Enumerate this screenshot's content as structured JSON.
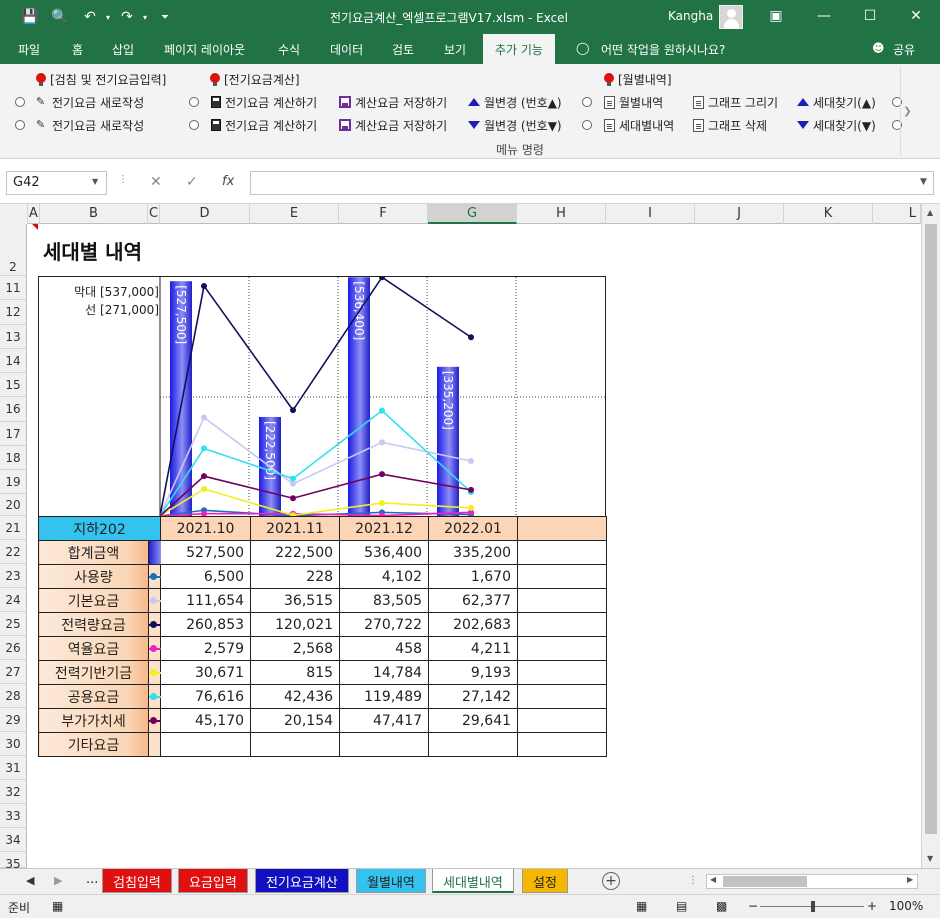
{
  "window": {
    "title": "전기요금계산_엑셀프로그램V17.xlsm  -  Excel",
    "user": "Kangha"
  },
  "ribbon_tabs": [
    "파일",
    "홈",
    "삽입",
    "페이지 레이아웃",
    "수식",
    "데이터",
    "검토",
    "보기",
    "추가 기능"
  ],
  "tell_me": "어떤 작업을 원하시나요?",
  "share": "공유",
  "ribbon": {
    "group1_title": "[검침 및 전기요금입력]",
    "group2_title": "[전기요금계산]",
    "group3_title": "[월별내역]",
    "new_bill_1": "전기요금 새로작성",
    "new_bill_2": "전기요금 새로작성",
    "calc_1": "전기요금 계산하기",
    "calc_2": "전기요금 계산하기",
    "save_1": "계산요금 저장하기",
    "save_2": "계산요금 저장하기",
    "month_up": "월변경 (번호▲)",
    "month_down": "월변경 (번호▼)",
    "monthly": "월별내역",
    "household": "세대별내역",
    "draw_graph": "그래프 그리기",
    "delete_graph": "그래프 삭제",
    "find_up": "세대찾기(▲)",
    "find_down": "세대찾기(▼)",
    "group_label": "메뉴 명령"
  },
  "formula_bar": {
    "name_box": "G42",
    "formula": ""
  },
  "columns": [
    "A",
    "B",
    "C",
    "D",
    "E",
    "F",
    "G",
    "H",
    "I",
    "J",
    "K",
    "L"
  ],
  "rows": [
    "2",
    "11",
    "12",
    "13",
    "14",
    "15",
    "16",
    "17",
    "18",
    "19",
    "20",
    "21",
    "22",
    "23",
    "24",
    "25",
    "26",
    "27",
    "28",
    "29",
    "30",
    "31",
    "32",
    "33",
    "34",
    "35"
  ],
  "sheet": {
    "title": "세대별 내역",
    "legend_bar": "막대 [537,000]",
    "legend_line": "선 [271,000]",
    "unit": "지하202"
  },
  "chart_data": {
    "type": "bar",
    "categories": [
      "2021.10",
      "2021.11",
      "2021.12",
      "2022.01"
    ],
    "bar_series": {
      "name": "합계금액",
      "values": [
        527500,
        222500,
        536400,
        335200
      ],
      "labels": [
        "[527,500]",
        "[222,500]",
        "[536,400]",
        "[335,200]"
      ],
      "max": 537000
    },
    "line_max": 271000,
    "line_series": [
      {
        "name": "사용량",
        "values": [
          6500,
          228,
          4102,
          1670
        ],
        "color": "#1f6fb8"
      },
      {
        "name": "기본요금",
        "values": [
          111654,
          36515,
          83505,
          62377
        ],
        "color": "#c8c8f0"
      },
      {
        "name": "전력량요금",
        "values": [
          260853,
          120021,
          270722,
          202683
        ],
        "color": "#10105e"
      },
      {
        "name": "역율요금",
        "values": [
          2579,
          2568,
          458,
          4211
        ],
        "color": "#f020c0"
      },
      {
        "name": "전력기반기금",
        "values": [
          30671,
          815,
          14784,
          9193
        ],
        "color": "#f0f020"
      },
      {
        "name": "공용요금",
        "values": [
          76616,
          42436,
          119489,
          27142
        ],
        "color": "#30e0f0"
      },
      {
        "name": "부가가치세",
        "values": [
          45170,
          20154,
          47417,
          29641
        ],
        "color": "#700060"
      }
    ]
  },
  "table": {
    "months": [
      "2021.10",
      "2021.11",
      "2021.12",
      "2022.01"
    ],
    "rows": [
      {
        "label": "합계금액",
        "values": [
          "527,500",
          "222,500",
          "536,400",
          "335,200"
        ],
        "marker": "bar",
        "color": "#3030e0"
      },
      {
        "label": "사용량",
        "values": [
          "6,500",
          "228",
          "4,102",
          "1,670"
        ],
        "marker": "line",
        "color": "#1f6fb8"
      },
      {
        "label": "기본요금",
        "values": [
          "111,654",
          "36,515",
          "83,505",
          "62,377"
        ],
        "marker": "line",
        "color": "#c8c8f0"
      },
      {
        "label": "전력량요금",
        "values": [
          "260,853",
          "120,021",
          "270,722",
          "202,683"
        ],
        "marker": "line",
        "color": "#10105e"
      },
      {
        "label": "역율요금",
        "values": [
          "2,579",
          "2,568",
          "458",
          "4,211"
        ],
        "marker": "line",
        "color": "#f020c0"
      },
      {
        "label": "전력기반기금",
        "values": [
          "30,671",
          "815",
          "14,784",
          "9,193"
        ],
        "marker": "line",
        "color": "#f0f020"
      },
      {
        "label": "공용요금",
        "values": [
          "76,616",
          "42,436",
          "119,489",
          "27,142"
        ],
        "marker": "line",
        "color": "#30e0f0"
      },
      {
        "label": "부가가치세",
        "values": [
          "45,170",
          "20,154",
          "47,417",
          "29,641"
        ],
        "marker": "line",
        "color": "#700060"
      },
      {
        "label": "기타요금",
        "values": [
          "",
          "",
          "",
          ""
        ],
        "marker": "none",
        "color": "#fbe1c9"
      }
    ]
  },
  "sheet_tabs": [
    {
      "label": "...",
      "bg": "#f0f0f0",
      "fg": "#222"
    },
    {
      "label": "검침입력",
      "bg": "#e01010",
      "fg": "#ffffff"
    },
    {
      "label": "요금입력",
      "bg": "#e01010",
      "fg": "#ffffff"
    },
    {
      "label": "전기요금계산",
      "bg": "#1010c0",
      "fg": "#ffffff"
    },
    {
      "label": "월별내역",
      "bg": "#33c3ee",
      "fg": "#222222"
    },
    {
      "label": "세대별내역",
      "bg": "#ffffff",
      "fg": "#217346"
    },
    {
      "label": "설정",
      "bg": "#f5b800",
      "fg": "#222222"
    }
  ],
  "status": {
    "ready": "준비",
    "zoom": "100%",
    "minus": "−",
    "plus": "+"
  }
}
